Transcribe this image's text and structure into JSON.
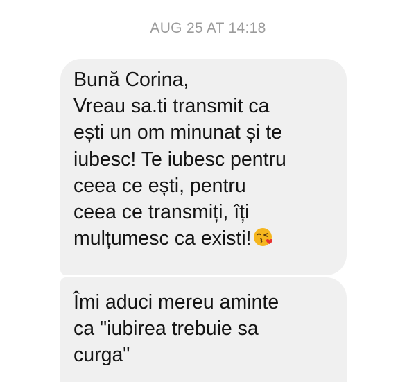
{
  "thread": {
    "timestamp": "AUG 25 AT 14:18"
  },
  "messages": [
    {
      "lines": [
        "Bună Corina,",
        "Vreau sa.ti transmit ca",
        "ești un om minunat și te",
        "iubesc! Te iubesc pentru",
        "ceea ce ești, pentru",
        "ceea ce transmiți, îți",
        "mulțumesc ca existi!"
      ],
      "trailing_emoji": "face-blowing-a-kiss-icon"
    },
    {
      "lines": [
        "Îmi aduci mereu aminte",
        "ca \"iubirea trebuie sa",
        "curga\""
      ]
    }
  ],
  "colors": {
    "background": "#ffffff",
    "bubble": "#f0f0f0",
    "text": "#141414",
    "timestamp": "#9b9b9b",
    "emoji_face": "#f5b61f",
    "emoji_heart": "#e8322f"
  }
}
